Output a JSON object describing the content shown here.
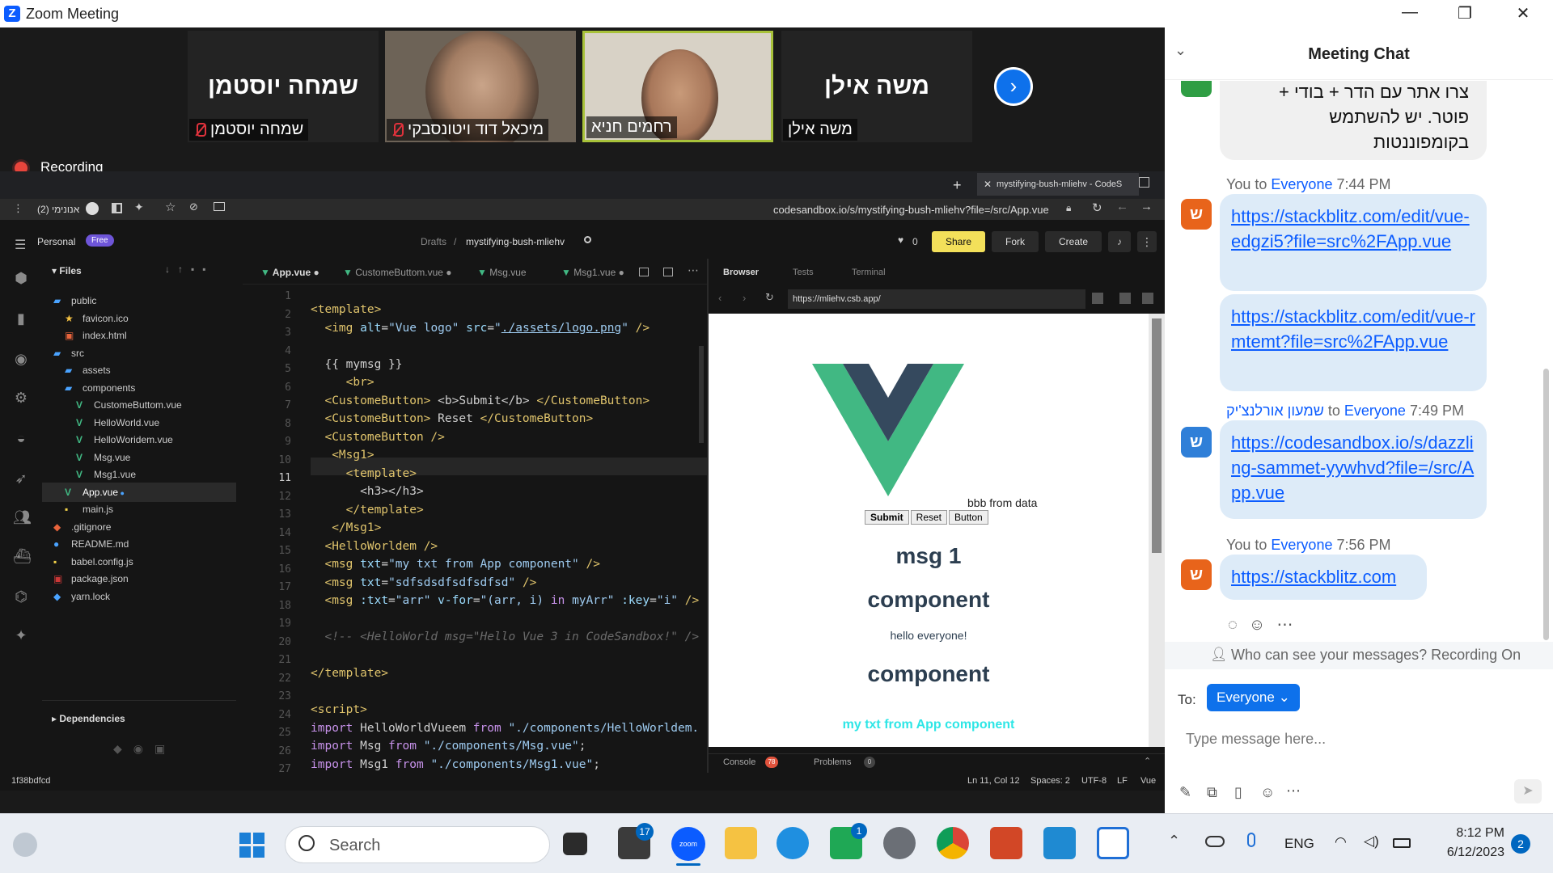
{
  "window": {
    "title": "Zoom Meeting",
    "minimize": "—",
    "restore": "❐",
    "close": "✕"
  },
  "gallery": {
    "tiles": [
      {
        "big": "שמחה יוסטמן",
        "name": "שמחה יוסטמן",
        "muted": true,
        "video": false
      },
      {
        "big": "",
        "name": "מיכאל דוד ויטונסבקי",
        "muted": true,
        "video": true
      },
      {
        "big": "",
        "name": "רחמים חניא",
        "muted": false,
        "video": true
      },
      {
        "big": "משה אילן",
        "name": "משה אילן",
        "muted": false,
        "video": false
      }
    ],
    "next_icon": "›"
  },
  "recording": {
    "label": "Recording"
  },
  "browser": {
    "tab_title": "mystifying-bush-mliehv - CodeS",
    "url": "codesandbox.io/s/mystifying-bush-mliehv?file=/src/App.vue",
    "profile": "אנונימי (2)"
  },
  "csb": {
    "workspace": "Personal",
    "plan": "Free",
    "path_prefix": "Drafts",
    "sep": "/",
    "sandbox": "mystifying-bush-mliehv",
    "likes": "0",
    "share": "Share",
    "fork": "Fork",
    "create": "Create",
    "files_label": "Files",
    "deps_label": "Dependencies",
    "files": [
      {
        "name": "public",
        "type": "folder",
        "indent": 0
      },
      {
        "name": "favicon.ico",
        "type": "star",
        "indent": 1
      },
      {
        "name": "index.html",
        "type": "html",
        "indent": 1
      },
      {
        "name": "src",
        "type": "folder",
        "indent": 0
      },
      {
        "name": "assets",
        "type": "folder",
        "indent": 1
      },
      {
        "name": "components",
        "type": "folder",
        "indent": 1
      },
      {
        "name": "CustomeButtom.vue",
        "type": "vue",
        "indent": 2
      },
      {
        "name": "HelloWorld.vue",
        "type": "vue",
        "indent": 2
      },
      {
        "name": "HelloWoridem.vue",
        "type": "vue",
        "indent": 2
      },
      {
        "name": "Msg.vue",
        "type": "vue",
        "indent": 2
      },
      {
        "name": "Msg1.vue",
        "type": "vue",
        "indent": 2
      },
      {
        "name": "App.vue",
        "type": "vue",
        "indent": 1,
        "selected": true
      },
      {
        "name": "main.js",
        "type": "js",
        "indent": 1
      },
      {
        "name": ".gitignore",
        "type": "git",
        "indent": 0
      },
      {
        "name": "README.md",
        "type": "info",
        "indent": 0
      },
      {
        "name": "babel.config.js",
        "type": "js",
        "indent": 0
      },
      {
        "name": "package.json",
        "type": "npm",
        "indent": 0
      },
      {
        "name": "yarn.lock",
        "type": "yarn",
        "indent": 0
      }
    ],
    "editor_tabs": [
      "App.vue",
      "CustomeButtom.vue",
      "Msg.vue",
      "Msg1.vue"
    ],
    "code_lines": [
      "1",
      "2",
      "3",
      "4",
      "5",
      "6",
      "7",
      "8",
      "9",
      "10",
      "11",
      "12",
      "13",
      "14",
      "15",
      "16",
      "17",
      "18",
      "19",
      "20",
      "21",
      "22",
      "23",
      "24",
      "25",
      "26",
      "27"
    ],
    "preview_tabs": [
      "Browser",
      "Tests",
      "Terminal"
    ],
    "preview_url": "https://mliehv.csb.app/",
    "preview": {
      "bbb": "bbb from data",
      "buttons": [
        "Submit",
        "Reset",
        "Button"
      ],
      "msg1": "msg 1",
      "comp1": "component",
      "hello": "hello everyone!",
      "comp2": "component",
      "mytxt": "my txt from App component"
    },
    "console": "Console",
    "console_count": "78",
    "problems": "Problems",
    "problems_count": "0",
    "status": {
      "hash": "1f38bdfcd",
      "pos": "Ln 11, Col 12",
      "spaces": "Spaces: 2",
      "enc": "UTF-8",
      "eol": "LF",
      "lang": "Vue"
    }
  },
  "chat": {
    "title": "Meeting Chat",
    "prev_text": "צרו אתר עם הדר + בודי + פוטר. יש להשתמש בקומפוננטות",
    "m1_from": "You",
    "m1_to_word": "to",
    "m1_to": "Everyone",
    "m1_time": "7:44 PM",
    "m1_link1": "https://stackblitz.com/edit/vue-edgzi5?file=src%2FApp.vue",
    "m1_link2": "https://stackblitz.com/edit/vue-rmtemt?file=src%2FApp.vue",
    "m2_from": "שמעון אורלנצ'יק",
    "m2_to_word": "to",
    "m2_to": "Everyone",
    "m2_time": "7:49 PM",
    "m2_link": "https://codesandbox.io/s/dazzling-sammet-yywhvd?file=/src/App.vue",
    "m3_from": "You",
    "m3_to_word": "to",
    "m3_to": "Everyone",
    "m3_time": "7:56 PM",
    "m3_link": "https://stackblitz.com",
    "avatar_letter": "ש",
    "privacy": "Who can see your messages? Recording On",
    "to_label": "To:",
    "to_value": "Everyone",
    "placeholder": "Type message here..."
  },
  "taskbar": {
    "search": "Search",
    "lang": "ENG",
    "time": "8:12 PM",
    "date": "6/12/2023",
    "notif": "2",
    "badge_a": "17",
    "badge_b": "1"
  },
  "colors": {
    "zoom_blue": "#0b5cff",
    "vue_green": "#41b883",
    "vue_dark": "#35495e",
    "share_yellow": "#f3e05a",
    "avatar_orange": "#e8641b",
    "avatar_blue": "#2f7fd8",
    "mytxt_cyan": "#2ee6e6"
  }
}
